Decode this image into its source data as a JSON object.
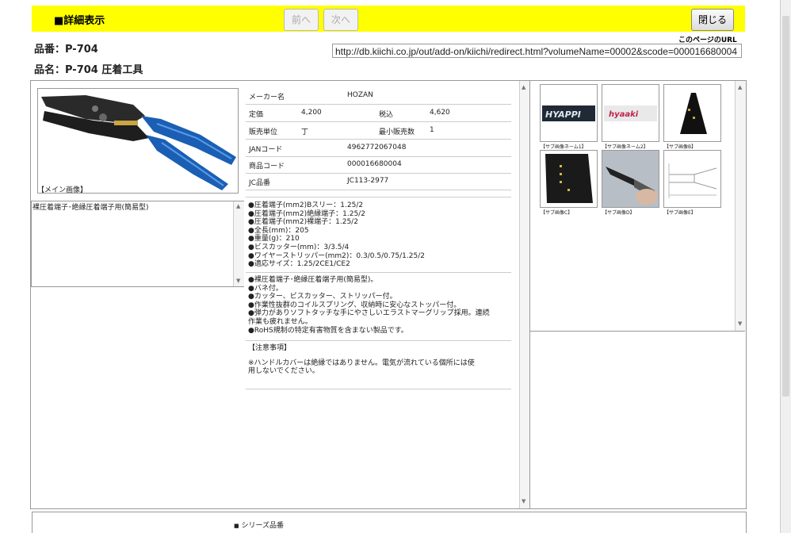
{
  "header": {
    "title": "■詳細表示",
    "prev_label": "前へ",
    "next_label": "次へ",
    "close_label": "閉じる",
    "bg_color": "#ffff00"
  },
  "product": {
    "number_label": "品番：P-704",
    "name_label": "品名：P-704 圧着工具"
  },
  "url": {
    "caption": "このページのURL",
    "value": "http://db.kiichi.co.jp/out/add-on/kiichi/redirect.html?volumeName=00002&scode=000016680004"
  },
  "main_image": {
    "caption": "【メイン画像】"
  },
  "description_box": {
    "text": "裸圧着端子･絶縁圧着端子用(簡易型)"
  },
  "specs": {
    "maker_label": "メーカー名",
    "maker_value": "HOZAN",
    "price_label": "定価",
    "price_value": "4,200",
    "taxin_label": "税込",
    "taxin_value": "4,620",
    "unit_label": "販売単位",
    "unit_value": "丁",
    "min_label": "最小販売数",
    "min_value": "1",
    "jan_label": "JANコード",
    "jan_value": "4962772067048",
    "code_label": "商品コード",
    "code_value": "000016680004",
    "jc_label": "JC品番",
    "jc_value": "JC113-2977"
  },
  "features": [
    "●圧着端子(mm2)Bスリー：1.25/2",
    "●圧着端子(mm2)絶縁端子：1.25/2",
    "●圧着端子(mm2)裸端子：1.25/2",
    "●全長(mm)：205",
    "●重量(g)：210",
    "●ビスカッター(mm)：3/3.5/4",
    "●ワイヤーストリッパー(mm2)：0.3/0.5/0.75/1.25/2",
    "●適応サイズ：1.25/2CE1/CE2"
  ],
  "notes": [
    "●裸圧着端子･絶縁圧着端子用(簡易型)。",
    "●バネ付。",
    "●カッター、ビスカッター、ストリッパー付。",
    "●作業性抜群のコイルスプリング、収納時に安心なストッパー付。",
    "●弾力がありソフトタッチな手にやさしいエラストマーグリップ採用。連続",
    "作業も疲れません。",
    "●RoHS規制の特定有害物質を含まない製品です。"
  ],
  "caution": {
    "heading": "【注意事項】",
    "line1": "※ハンドルカバーは絶縁ではありません。電気が流れている個所には使",
    "line2": "用しないでください。"
  },
  "thumbnails": [
    {
      "caption": "【サブ画像ネーム1】",
      "label": "HYAPPI"
    },
    {
      "caption": "【サブ画像ネーム2】",
      "label": "hyaaki"
    },
    {
      "caption": "【サブ画像B】",
      "label": ""
    },
    {
      "caption": "【サブ画像C】",
      "label": ""
    },
    {
      "caption": "【サブ画像D】",
      "label": ""
    },
    {
      "caption": "【サブ画像E】",
      "label": ""
    }
  ],
  "footer": {
    "series_label": "シリーズ品番"
  }
}
